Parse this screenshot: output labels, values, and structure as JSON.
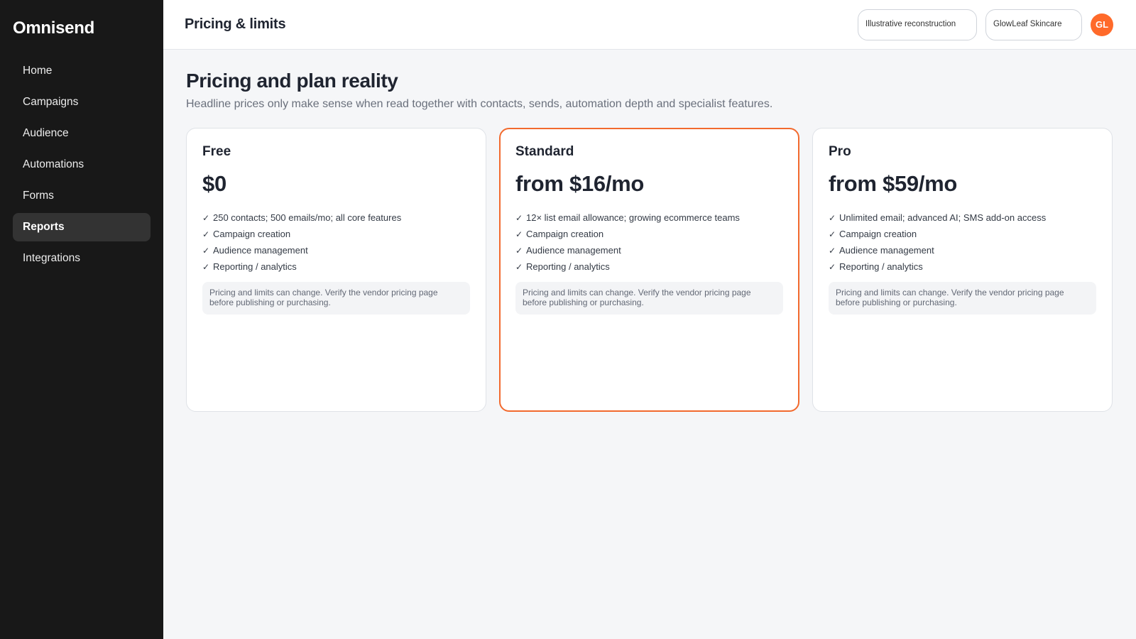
{
  "app": {
    "brand": "Omnisend"
  },
  "sidebar": {
    "items": [
      {
        "label": "Home"
      },
      {
        "label": "Campaigns"
      },
      {
        "label": "Audience"
      },
      {
        "label": "Automations"
      },
      {
        "label": "Forms"
      },
      {
        "label": "Reports",
        "active": true
      },
      {
        "label": "Integrations"
      }
    ]
  },
  "header": {
    "title": "Pricing & limits",
    "pills": [
      "Illustrative reconstruction",
      "GlowLeaf Skincare"
    ],
    "avatar": "GL"
  },
  "main": {
    "title": "Pricing and plan reality",
    "subtitle": "Headline prices only make sense when read together with contacts, sends, automation depth and specialist features.",
    "plans": [
      {
        "name": "Free",
        "price": "$0",
        "features": [
          "250 contacts; 500 emails/mo; all core features",
          "Campaign creation",
          "Audience management",
          "Reporting / analytics"
        ],
        "note": "Pricing and limits can change. Verify the vendor pricing page before publishing or purchasing."
      },
      {
        "name": "Standard",
        "price": "from $16/mo",
        "highlighted": true,
        "features": [
          "12× list email allowance; growing ecommerce teams",
          "Campaign creation",
          "Audience management",
          "Reporting / analytics"
        ],
        "note": "Pricing and limits can change. Verify the vendor pricing page before publishing or purchasing."
      },
      {
        "name": "Pro",
        "price": "from $59/mo",
        "features": [
          "Unlimited email; advanced AI; SMS add-on access",
          "Campaign creation",
          "Audience management",
          "Reporting / analytics"
        ],
        "note": "Pricing and limits can change. Verify the vendor pricing page before publishing or purchasing."
      }
    ]
  },
  "colors": {
    "sidebar": "#181818",
    "accent": "#ff6a2a",
    "highlight_border": "#f26a2e",
    "background": "#f5f6f8"
  },
  "icons": {
    "check": "check-icon"
  }
}
